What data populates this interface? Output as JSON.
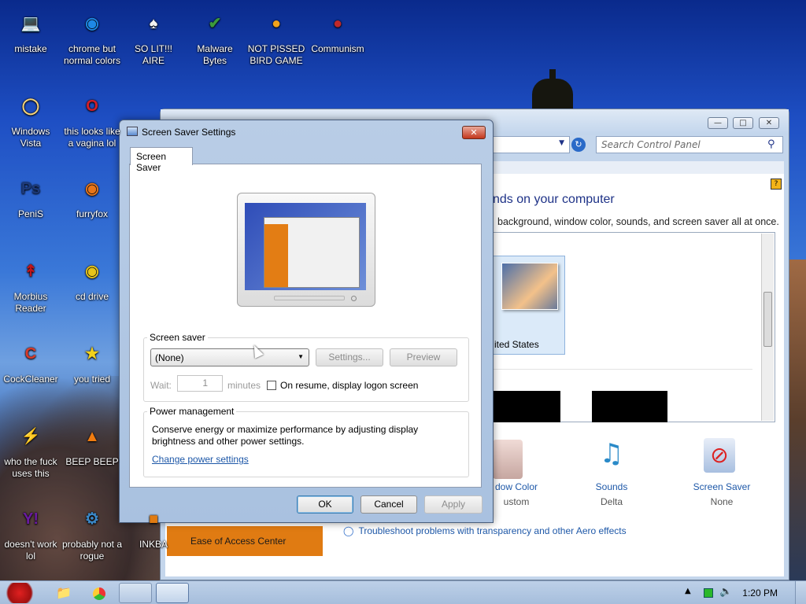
{
  "desktop": {
    "icons": [
      {
        "label": "mistake",
        "icon": "computer-icon",
        "color": "#d9a21c"
      },
      {
        "label": "chrome but normal colors",
        "icon": "chrome-icon",
        "color": "#1e88e5"
      },
      {
        "label": "SO LIT!!! AIRE",
        "icon": "cards-icon",
        "color": "#f2f2f2"
      },
      {
        "label": "Malware Bytes",
        "icon": "shield-icon",
        "color": "#3c9a3c"
      },
      {
        "label": "NOT PISSED BIRD GAME",
        "icon": "bird-icon",
        "color": "#f1a21a"
      },
      {
        "label": "Communism",
        "icon": "bird-icon",
        "color": "#c0282a"
      },
      {
        "label": "Windows Vista",
        "icon": "egg-icon",
        "color": "#f5d37a"
      },
      {
        "label": "this looks like a vagina lol",
        "icon": "opera-icon",
        "color": "#d21e2a"
      },
      {
        "label": "PeniS",
        "icon": "photoshop-icon",
        "color": "#1d3a7a"
      },
      {
        "label": "furryfox",
        "icon": "firefox-icon",
        "color": "#e8751a"
      },
      {
        "label": "Morbius Reader",
        "icon": "pdf-icon",
        "color": "#c0141a"
      },
      {
        "label": "cd drive",
        "icon": "cd-icon",
        "color": "#e6c41a"
      },
      {
        "label": "CockCleaner",
        "icon": "ccleaner-icon",
        "color": "#d83a2a"
      },
      {
        "label": "you tried",
        "icon": "star-icon",
        "color": "#f2d11c"
      },
      {
        "label": "who the fuck uses this",
        "icon": "lightning-icon",
        "color": "#e8711a"
      },
      {
        "label": "BEEP BEEP",
        "icon": "cone-icon",
        "color": "#f07c10"
      },
      {
        "label": "doesn't work lol",
        "icon": "yahoo-icon",
        "color": "#6a1aa0"
      },
      {
        "label": "probably not a rogue",
        "icon": "gear-icon",
        "color": "#3a88c8"
      },
      {
        "label": "INKBA",
        "icon": "ink-icon",
        "color": "#e07b12"
      }
    ]
  },
  "control_panel": {
    "search_placeholder": "Search Control Panel",
    "heading": "nds on your computer",
    "description": "background, window color, sounds, and screen saver all at once.",
    "theme_label": "ited States",
    "tiles": [
      {
        "title": "dow Color",
        "subtitle": "ustom"
      },
      {
        "title": "Sounds",
        "subtitle": "Delta"
      },
      {
        "title": "Screen Saver",
        "subtitle": "None"
      }
    ],
    "ease_access": "Ease of Access Center",
    "troubleshoot": "Troubleshoot problems with transparency and other Aero effects"
  },
  "dialog": {
    "title": "Screen Saver Settings",
    "tab": "Screen Saver",
    "screensaver_group": "Screen saver",
    "screensaver_value": "(None)",
    "settings_button": "Settings...",
    "preview_button": "Preview",
    "wait_label": "Wait:",
    "wait_value": "1",
    "minutes_label": "minutes",
    "resume_label": "On resume, display logon screen",
    "power_group": "Power management",
    "power_text": "Conserve energy or maximize performance by adjusting display brightness and other power settings.",
    "power_link": "Change power settings",
    "ok": "OK",
    "cancel": "Cancel",
    "apply": "Apply"
  },
  "taskbar": {
    "time": "1:20 PM"
  }
}
